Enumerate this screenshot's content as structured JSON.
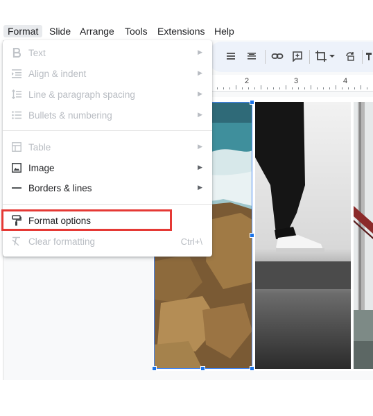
{
  "menubar": {
    "items": [
      "Format",
      "Slide",
      "Arrange",
      "Tools",
      "Extensions",
      "Help"
    ]
  },
  "format_menu": {
    "items": [
      {
        "label": "Text",
        "icon": "bold-icon",
        "enabled": false,
        "submenu": true
      },
      {
        "label": "Align & indent",
        "icon": "align-indent-icon",
        "enabled": false,
        "submenu": true
      },
      {
        "label": "Line & paragraph spacing",
        "icon": "line-spacing-icon",
        "enabled": false,
        "submenu": true
      },
      {
        "label": "Bullets & numbering",
        "icon": "bulleted-list-icon",
        "enabled": false,
        "submenu": true
      },
      {
        "label": "Table",
        "icon": "table-icon",
        "enabled": false,
        "submenu": true
      },
      {
        "label": "Image",
        "icon": "image-icon",
        "enabled": true,
        "submenu": true
      },
      {
        "label": "Borders & lines",
        "icon": "line-icon",
        "enabled": true,
        "submenu": true
      },
      {
        "label": "Format options",
        "icon": "paint-format-icon",
        "enabled": true,
        "submenu": false
      },
      {
        "label": "Clear formatting",
        "icon": "clear-formatting-icon",
        "enabled": false,
        "shortcut": "Ctrl+\\"
      }
    ]
  },
  "ruler": {
    "labels": [
      "2",
      "3",
      "4"
    ]
  },
  "colors": {
    "selection": "#1a73e8",
    "highlight": "#e53935",
    "toolbar_bg": "#edf2fa"
  }
}
